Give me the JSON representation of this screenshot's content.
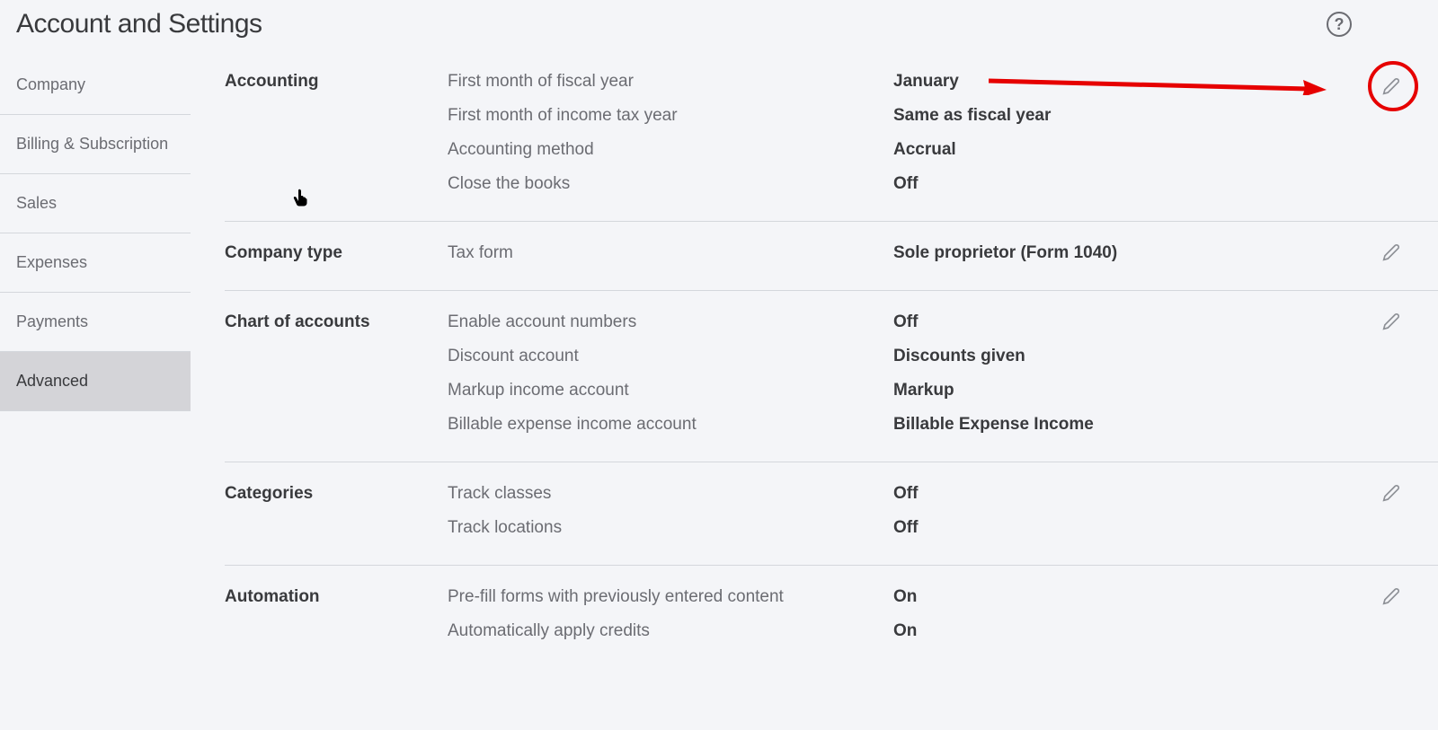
{
  "header": {
    "title": "Account and Settings"
  },
  "sidebar": {
    "items": [
      {
        "label": "Company"
      },
      {
        "label": "Billing & Subscription"
      },
      {
        "label": "Sales"
      },
      {
        "label": "Expenses"
      },
      {
        "label": "Payments"
      },
      {
        "label": "Advanced"
      }
    ]
  },
  "sections": {
    "accounting": {
      "title": "Accounting",
      "rows": [
        {
          "label": "First month of fiscal year",
          "value": "January"
        },
        {
          "label": "First month of income tax year",
          "value": "Same as fiscal year"
        },
        {
          "label": "Accounting method",
          "value": "Accrual"
        },
        {
          "label": "Close the books",
          "value": "Off"
        }
      ]
    },
    "company_type": {
      "title": "Company type",
      "rows": [
        {
          "label": "Tax form",
          "value": "Sole proprietor (Form 1040)"
        }
      ]
    },
    "chart_of_accounts": {
      "title": "Chart of accounts",
      "rows": [
        {
          "label": "Enable account numbers",
          "value": "Off"
        },
        {
          "label": "Discount account",
          "value": "Discounts given"
        },
        {
          "label": "Markup income account",
          "value": "Markup"
        },
        {
          "label": "Billable expense income account",
          "value": "Billable Expense Income"
        }
      ]
    },
    "categories": {
      "title": "Categories",
      "rows": [
        {
          "label": "Track classes",
          "value": "Off"
        },
        {
          "label": "Track locations",
          "value": "Off"
        }
      ]
    },
    "automation": {
      "title": "Automation",
      "rows": [
        {
          "label": "Pre-fill forms with previously entered content",
          "value": "On"
        },
        {
          "label": "Automatically apply credits",
          "value": "On"
        }
      ]
    }
  }
}
